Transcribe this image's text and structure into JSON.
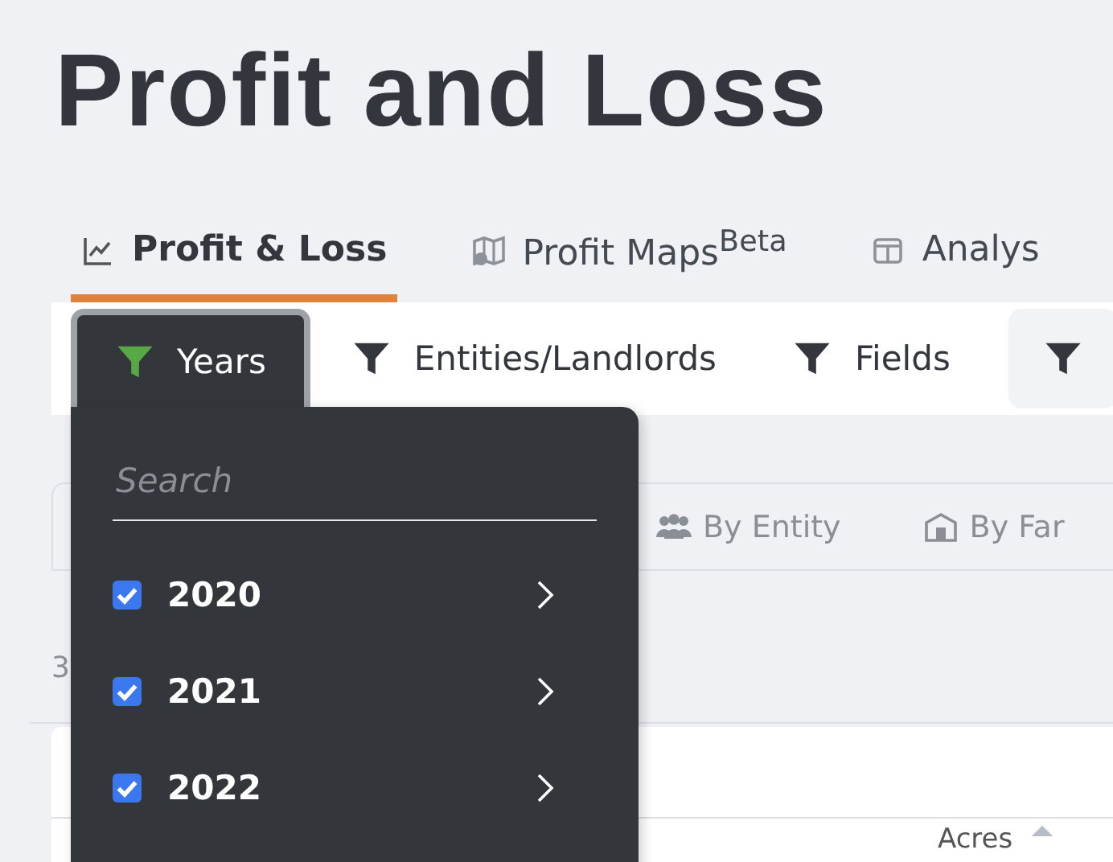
{
  "page_title": "Profit and Loss",
  "tabs": [
    {
      "label": "Profit & Loss",
      "selected": true
    },
    {
      "label": "Profit Maps$^{Beta}$",
      "selected": false
    },
    {
      "label": "Analys",
      "selected": false
    }
  ],
  "filters": [
    {
      "label": "Years",
      "active": true
    },
    {
      "label": "Entities/Landlords",
      "active": false
    },
    {
      "label": "Fields",
      "active": false
    }
  ],
  "years_dropdown": {
    "search": {
      "placeholder": "Search"
    },
    "items": [
      {
        "label": "2020",
        "checked": true
      },
      {
        "label": "2021",
        "checked": true
      },
      {
        "label": "2022",
        "checked": true
      }
    ]
  },
  "view_tabs": [
    {
      "label": "By Entity"
    },
    {
      "label": "By Far"
    }
  ],
  "count_text": "3",
  "table": {
    "columns": [
      "Acres"
    ]
  }
}
